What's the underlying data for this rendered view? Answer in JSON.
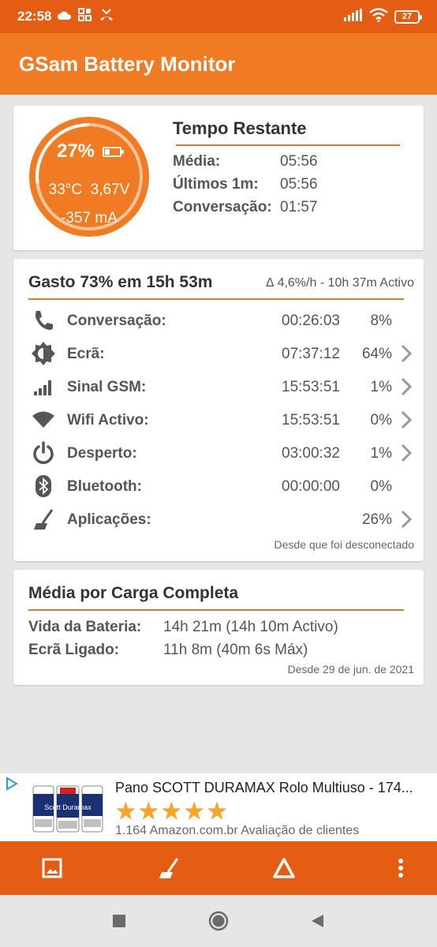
{
  "status_bar": {
    "time": "22:58",
    "battery_level": "27",
    "icons": [
      "cloud-icon",
      "grid-icon",
      "missed-call-icon",
      "signal-icon",
      "wifi-icon",
      "battery-icon"
    ]
  },
  "app_bar": {
    "title": "GSam Battery Monitor"
  },
  "battery_gauge": {
    "percent_label": "27%",
    "percent_value": 27,
    "temperature": "33°C",
    "voltage": "3,67V",
    "current": "-357 mA"
  },
  "time_remaining": {
    "title": "Tempo Restante",
    "rows": [
      {
        "label": "Média:",
        "value": "05:56"
      },
      {
        "label": "Últimos 1m:",
        "value": "05:56"
      },
      {
        "label": "Conversação:",
        "value": "01:57"
      }
    ]
  },
  "usage": {
    "title": "Gasto 73% em 15h 53m",
    "rate": "∆ 4,6%/h - 10h 37m Activo",
    "rows": [
      {
        "icon": "phone-icon",
        "label": "Conversação:",
        "time": "00:26:03",
        "pct": "8%",
        "chevron": false
      },
      {
        "icon": "screen-brightness-icon",
        "label": "Ecrã:",
        "time": "07:37:12",
        "pct": "64%",
        "chevron": true
      },
      {
        "icon": "signal-bars-icon",
        "label": "Sinal GSM:",
        "time": "15:53:51",
        "pct": "1%",
        "chevron": true
      },
      {
        "icon": "wifi-icon",
        "label": "Wifi Activo:",
        "time": "15:53:51",
        "pct": "0%",
        "chevron": true
      },
      {
        "icon": "power-icon",
        "label": "Desperto:",
        "time": "03:00:32",
        "pct": "1%",
        "chevron": true
      },
      {
        "icon": "bluetooth-icon",
        "label": "Bluetooth:",
        "time": "00:00:00",
        "pct": "0%",
        "chevron": false
      },
      {
        "icon": "apps-broom-icon",
        "label": "Aplicações:",
        "time": "",
        "pct": "26%",
        "chevron": true
      }
    ],
    "since": "Desde que foi desconectado"
  },
  "full_charge": {
    "title": "Média por Carga Completa",
    "rows": [
      {
        "label": "Vida da Bateria:",
        "value": "14h 21m (14h 10m Activo)"
      },
      {
        "label": "Ecrã Ligado:",
        "value": "11h 8m (40m 6s Máx)"
      }
    ],
    "since": "Desde 29 de jun. de 2021"
  },
  "ad": {
    "title": "Pano SCOTT DURAMAX Rolo Multiuso - 174...",
    "rating_stars": 5,
    "subtitle": "1.164 Amazon.com.br Avaliação de clientes",
    "image_text": "Scott Duramax"
  },
  "toolbar": {
    "buttons": [
      "image-icon",
      "broom-icon",
      "delta-icon",
      "more-vert-icon"
    ]
  },
  "nav_bar": {
    "buttons": [
      "recents-square-icon",
      "home-circle-icon",
      "back-triangle-icon"
    ]
  },
  "colors": {
    "status_bar": "#e45d12",
    "app_bar": "#f07b23",
    "accent_line": "#e07a27",
    "gauge_fill": "#f07b23"
  }
}
